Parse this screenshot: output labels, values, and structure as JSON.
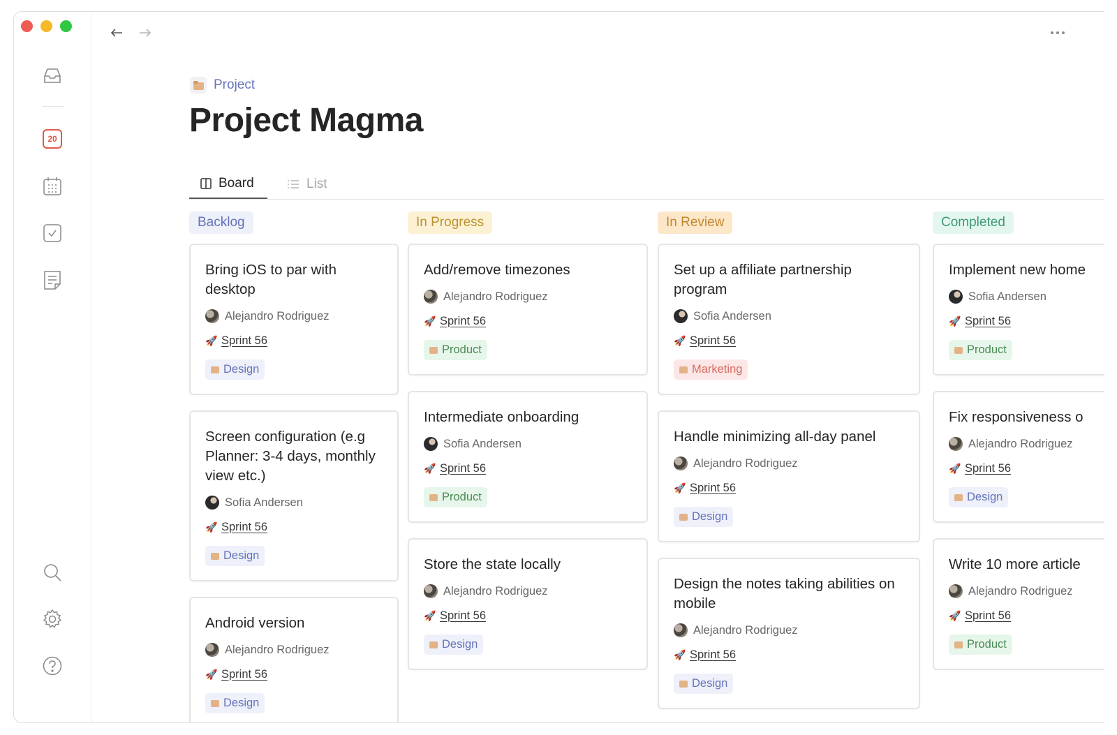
{
  "calendar_day": "20",
  "breadcrumb": {
    "label": "Project"
  },
  "page_title": "Project Magma",
  "tabs": [
    {
      "label": "Board",
      "active": true,
      "icon": "board-icon"
    },
    {
      "label": "List",
      "active": false,
      "icon": "list-icon"
    }
  ],
  "colors": {
    "backlog": "#eef0fa",
    "in_progress": "#fdf1d4",
    "in_review": "#fde7c9",
    "completed": "#e4f7ef",
    "accent": "#6874b7"
  },
  "columns": [
    {
      "label": "Backlog",
      "cards": [
        {
          "title": "Bring iOS to par with desktop",
          "assignee": "Alejandro Rodriguez",
          "sprint": "Sprint 56",
          "tag": "Design"
        },
        {
          "title": "Screen configuration (e.g Planner: 3-4 days, monthly view etc.)",
          "assignee": "Sofia Andersen",
          "sprint": "Sprint 56",
          "tag": "Design"
        },
        {
          "title": "Android version",
          "assignee": "Alejandro Rodriguez",
          "sprint": "Sprint 56",
          "tag": "Design"
        }
      ]
    },
    {
      "label": "In Progress",
      "cards": [
        {
          "title": "Add/remove timezones",
          "assignee": "Alejandro Rodriguez",
          "sprint": "Sprint 56",
          "tag": "Product"
        },
        {
          "title": "Intermediate onboarding",
          "assignee": "Sofia Andersen",
          "sprint": "Sprint 56",
          "tag": "Product"
        },
        {
          "title": "Store the state locally",
          "assignee": "Alejandro Rodriguez",
          "sprint": "Sprint 56",
          "tag": "Design"
        }
      ]
    },
    {
      "label": "In Review",
      "cards": [
        {
          "title": "Set up a affiliate partnership program",
          "assignee": "Sofia Andersen",
          "sprint": "Sprint 56",
          "tag": "Marketing"
        },
        {
          "title": "Handle minimizing all-day panel",
          "assignee": "Alejandro Rodriguez",
          "sprint": "Sprint 56",
          "tag": "Design"
        },
        {
          "title": "Design the notes taking abilities on mobile",
          "assignee": "Alejandro Rodriguez",
          "sprint": "Sprint 56",
          "tag": "Design"
        }
      ]
    },
    {
      "label": "Completed",
      "cards": [
        {
          "title": "Implement new home",
          "assignee": "Sofia Andersen",
          "sprint": "Sprint 56",
          "tag": "Product"
        },
        {
          "title": "Fix responsiveness o",
          "assignee": "Alejandro Rodriguez",
          "sprint": "Sprint 56",
          "tag": "Design"
        },
        {
          "title": "Write 10 more article",
          "assignee": "Alejandro Rodriguez",
          "sprint": "Sprint 56",
          "tag": "Product"
        }
      ]
    }
  ]
}
